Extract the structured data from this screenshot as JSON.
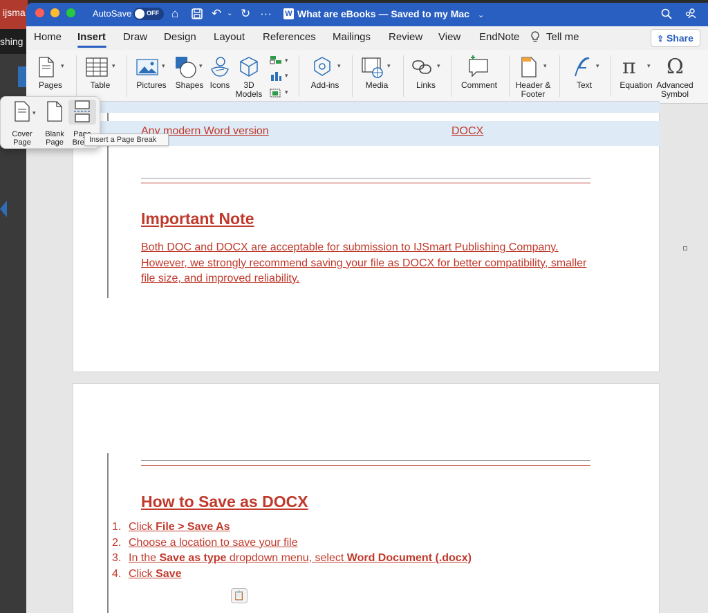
{
  "background_app": {
    "title_fragment": "ijsma",
    "sub_fragment": "shing"
  },
  "titlebar": {
    "autosave_label": "AutoSave",
    "autosave_state": "OFF",
    "word_icon_letter": "W",
    "doc_title": "What are eBooks — Saved to my Mac",
    "colors": {
      "bar": "#2a5fc2"
    }
  },
  "tabs": {
    "items": [
      "Home",
      "Insert",
      "Draw",
      "Design",
      "Layout",
      "References",
      "Mailings",
      "Review",
      "View",
      "EndNote"
    ],
    "active": "Insert",
    "tell_me": "Tell me",
    "share": "Share"
  },
  "ribbon": {
    "pages": "Pages",
    "table": "Table",
    "pictures": "Pictures",
    "shapes": "Shapes",
    "icons": "Icons",
    "models_3d_line1": "3D",
    "models_3d_line2": "Models",
    "addins": "Add-ins",
    "media": "Media",
    "links": "Links",
    "comment": "Comment",
    "header_footer_line1": "Header &",
    "header_footer_line2": "Footer",
    "text": "Text",
    "equation": "Equation",
    "symbol_line1": "Advanced",
    "symbol_line2": "Symbol"
  },
  "pages_popup": {
    "cover_line1": "Cover",
    "cover_line2": "Page",
    "blank_line1": "Blank",
    "blank_line2": "Page",
    "break_line1": "Page",
    "break_line2": "Break",
    "tooltip": "Insert a Page Break"
  },
  "document": {
    "table_row": {
      "left": "Any modern Word version",
      "right": "DOCX"
    },
    "important_heading": "Important Note",
    "important_para": "Both DOC and DOCX are acceptable for submission to IJSmart Publishing Company. However, we strongly recommend saving your file as DOCX for better compatibility, smaller file size, and improved reliability.",
    "save_heading": "How to Save as DOCX",
    "steps": [
      {
        "num": "1.",
        "pre": "Click ",
        "b1": "File > Save As",
        "mid": "",
        "b2": ""
      },
      {
        "num": "2.",
        "pre": "Choose a location to save your file",
        "b1": "",
        "mid": "",
        "b2": ""
      },
      {
        "num": "3.",
        "pre": "In the ",
        "b1": "Save as type",
        "mid": " dropdown menu, select ",
        "b2": "Word Document (.docx)"
      },
      {
        "num": "4.",
        "pre": "Click ",
        "b1": "Save",
        "mid": "",
        "b2": ""
      }
    ],
    "text_color": "#c0392b",
    "table_highlight": "#deeaf6"
  }
}
